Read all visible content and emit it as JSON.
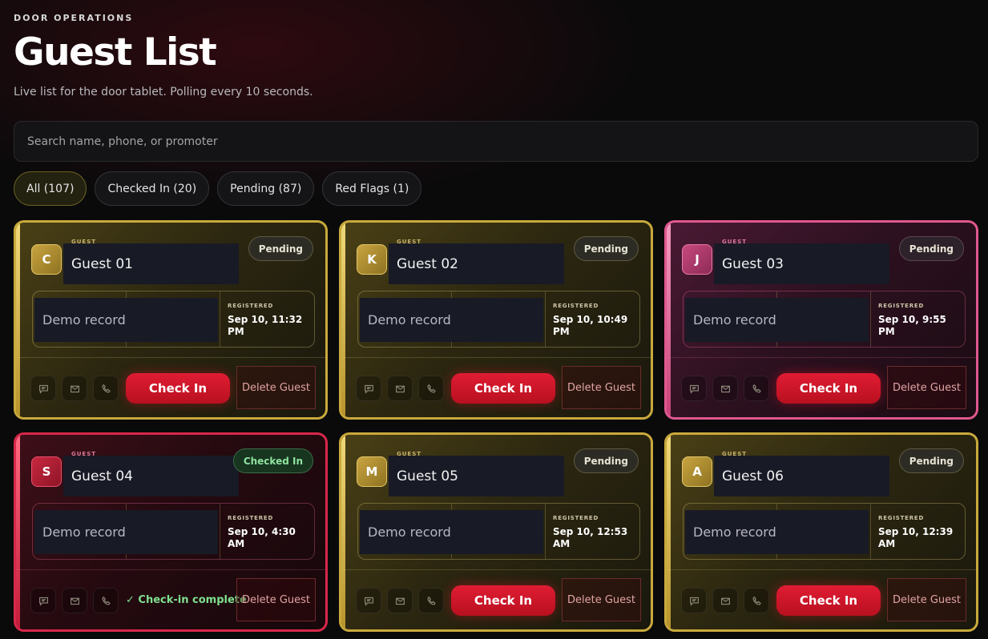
{
  "header": {
    "eyebrow": "DOOR OPERATIONS",
    "title": "Guest List",
    "subtitle": "Live list for the door tablet. Polling every 10 seconds."
  },
  "search": {
    "placeholder": "Search name, phone, or promoter",
    "value": ""
  },
  "filters": [
    {
      "label": "All (107)",
      "active": true
    },
    {
      "label": "Checked In (20)",
      "active": false
    },
    {
      "label": "Pending (87)",
      "active": false
    },
    {
      "label": "Red Flags (1)",
      "active": false
    }
  ],
  "labels": {
    "guest_tag": "GUEST",
    "registered": "REGISTERED",
    "check_in": "Check In",
    "delete": "Delete Guest",
    "complete": "✓ Check-in complete"
  },
  "colors": {
    "gold": "#c9a93c",
    "pink": "#e0588f",
    "red": "#d8284a",
    "accent": "#e01c33"
  },
  "guests": [
    {
      "initial": "C",
      "name": "Guest 01",
      "record": "Demo record",
      "status": "Pending",
      "registered": "Sep 10, 11:32 PM",
      "theme": "gold"
    },
    {
      "initial": "K",
      "name": "Guest 02",
      "record": "Demo record",
      "status": "Pending",
      "registered": "Sep 10, 10:49 PM",
      "theme": "gold"
    },
    {
      "initial": "J",
      "name": "Guest 03",
      "record": "Demo record",
      "status": "Pending",
      "registered": "Sep 10, 9:55 PM",
      "theme": "pink"
    },
    {
      "initial": "S",
      "name": "Guest 04",
      "record": "Demo record",
      "status": "Checked In",
      "registered": "Sep 10, 4:30 AM",
      "theme": "red"
    },
    {
      "initial": "M",
      "name": "Guest 05",
      "record": "Demo record",
      "status": "Pending",
      "registered": "Sep 10, 12:53 AM",
      "theme": "gold"
    },
    {
      "initial": "A",
      "name": "Guest 06",
      "record": "Demo record",
      "status": "Pending",
      "registered": "Sep 10, 12:39 AM",
      "theme": "gold"
    }
  ]
}
